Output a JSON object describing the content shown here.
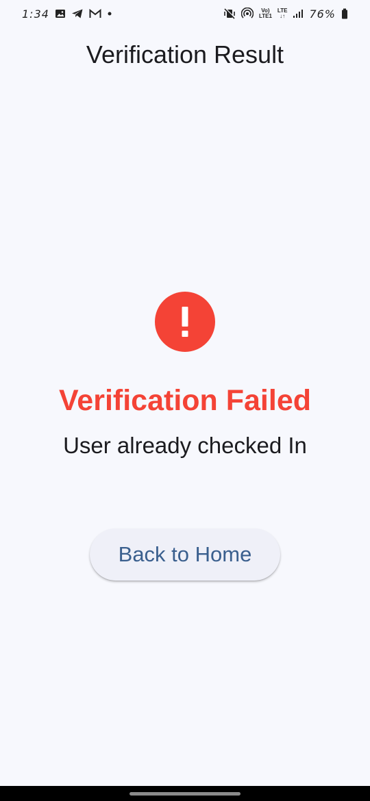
{
  "status_bar": {
    "time": "1:34",
    "left_icons": [
      "gallery-icon",
      "telegram-icon",
      "gmail-icon",
      "dot-icon"
    ],
    "right_icons": [
      "vibrate-icon",
      "hotspot-icon",
      "volte-icon",
      "lte-icon",
      "signal-icon",
      "battery-icon"
    ],
    "volte_top": "Vo)",
    "volte_bottom": "LTE1",
    "lte_top": "LTE",
    "lte_bottom": "↓↑",
    "battery": "76%"
  },
  "app_bar": {
    "title": "Verification Result"
  },
  "result": {
    "icon": "error-icon",
    "icon_color": "#f44336",
    "glyph": "!",
    "title": "Verification Failed",
    "title_color": "#f44336",
    "message": "User already checked In"
  },
  "actions": {
    "home_button": "Back to Home",
    "button_text_color": "#3a5f8e"
  },
  "colors": {
    "background": "#f7f8fd",
    "button_bg": "#eff0f8"
  }
}
